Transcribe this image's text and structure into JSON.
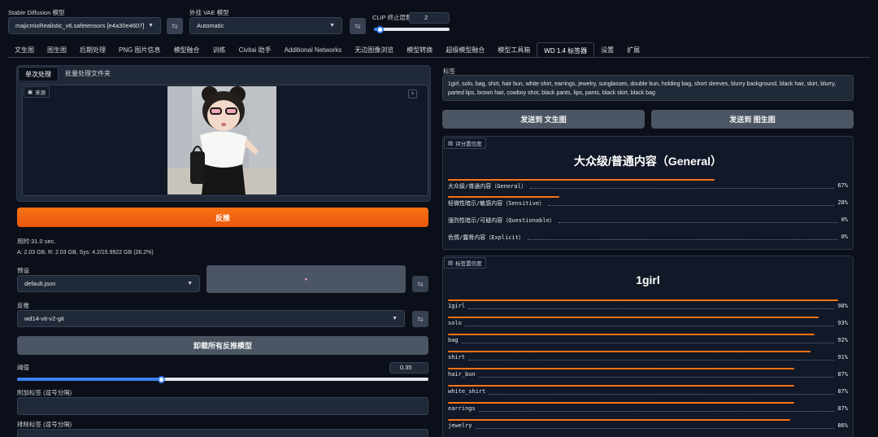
{
  "header": {
    "sd_model_label": "Stable Diffusion 模型",
    "sd_model_value": "majicmixRealistic_v6.safetensors [e4a30e4607]",
    "vae_label": "外挂 VAE 模型",
    "vae_value": "Automatic",
    "clip_label": "CLIP 终止层数",
    "clip_value": "2",
    "clip_slider_fraction": 0.08
  },
  "tabs": [
    {
      "label": "文生图"
    },
    {
      "label": "图生图"
    },
    {
      "label": "后期处理"
    },
    {
      "label": "PNG 图片信息"
    },
    {
      "label": "模型融合"
    },
    {
      "label": "训练"
    },
    {
      "label": "Civitai 助手"
    },
    {
      "label": "Additional Networks"
    },
    {
      "label": "无边图像浏览"
    },
    {
      "label": "模型转换"
    },
    {
      "label": "超级模型融合"
    },
    {
      "label": "模型工具箱"
    },
    {
      "label": "WD 1.4 标签器"
    },
    {
      "label": "设置"
    },
    {
      "label": "扩展"
    }
  ],
  "left": {
    "subtabs": [
      "单次处理",
      "批量处理文件夹"
    ],
    "source_label": "来源",
    "interrogate_button": "反推",
    "time_text": "用时:31.0 sec.",
    "mem_text": "A: 2.03 GB, R: 2.03 GB, Sys: 4.2/15.9922 GB (26.2%)",
    "preset_label": "预设",
    "preset_value": "default.json",
    "interrogator_label": "反推",
    "interrogator_value": "wd14-vit-v2-git",
    "unload_button": "卸载所有反推模型",
    "threshold_label": "阈值",
    "threshold_value": "0.35",
    "threshold_fraction": 0.35,
    "additional_tags_label": "附加标签 (逗号分隔)",
    "exclude_tags_label": "排除标签 (逗号分隔)"
  },
  "right": {
    "tags_label": "标签",
    "tags_text": "1girl, solo, bag, shirt, hair bun, white shirt, earrings, jewelry, sunglasses, double bun, holding bag, short sleeves, blurry background, black hair, skirt, blurry, parted lips, brown hair, cowboy shot, black pants, lips, pants, black skirt, black bag",
    "send_txt2img": "发送到 文生图",
    "send_img2img": "发送到 图生图",
    "rating_badge": "评分置信度",
    "rating_title": "大众级/普通内容（General）",
    "ratings": [
      {
        "name": "大众级/普通内容（General）",
        "pct": "67%",
        "value": 0.67
      },
      {
        "name": "轻微性暗示/敏感内容（Sensitive）",
        "pct": "28%",
        "value": 0.28
      },
      {
        "name": "强烈性暗示/可疑内容（Questionable）",
        "pct": "0%",
        "value": 0.0
      },
      {
        "name": "色情/露骨内容（Explicit）",
        "pct": "0%",
        "value": 0.0
      }
    ],
    "tag_badge": "标签置信度",
    "tag_title": "1girl",
    "tags": [
      {
        "name": "1girl",
        "pct": "98%",
        "value": 0.98
      },
      {
        "name": "solo",
        "pct": "93%",
        "value": 0.93
      },
      {
        "name": "bag",
        "pct": "92%",
        "value": 0.92
      },
      {
        "name": "shirt",
        "pct": "91%",
        "value": 0.91
      },
      {
        "name": "hair_bun",
        "pct": "87%",
        "value": 0.87
      },
      {
        "name": "white_shirt",
        "pct": "87%",
        "value": 0.87
      },
      {
        "name": "earrings",
        "pct": "87%",
        "value": 0.87
      },
      {
        "name": "jewelry",
        "pct": "86%",
        "value": 0.86
      }
    ]
  },
  "colors": {
    "accent": "#f97316",
    "slider": "#3b82f6",
    "bg": "#0b0f19"
  }
}
